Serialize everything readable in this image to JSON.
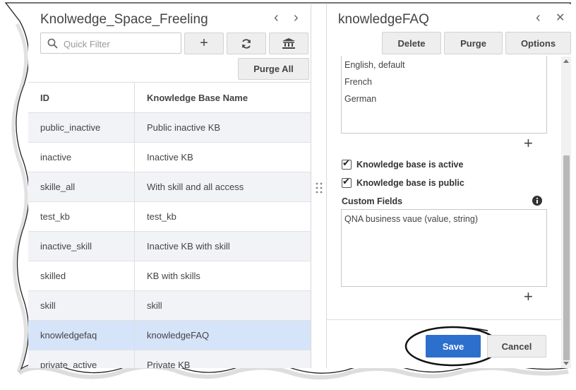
{
  "left_panel": {
    "title": "Knolwedge_Space_Freeling",
    "filter": {
      "placeholder": "Quick Filter",
      "value": ""
    },
    "buttons": {
      "add": "+",
      "refresh": "⟳",
      "kb": "🏛",
      "purge_all": "Purge All"
    },
    "table": {
      "headers": [
        "ID",
        "Knowledge Base Name"
      ],
      "rows": [
        [
          "public_inactive",
          "Public inactive KB"
        ],
        [
          "inactive",
          "Inactive KB"
        ],
        [
          "skille_all",
          "With skill and all access"
        ],
        [
          "test_kb",
          "test_kb"
        ],
        [
          "inactive_skill",
          "Inactive KB with skill"
        ],
        [
          "skilled",
          "KB with skills"
        ],
        [
          "skill",
          "skill"
        ],
        [
          "knowledgefaq",
          "knowledgeFAQ"
        ],
        [
          "private_active",
          "Private KB"
        ]
      ],
      "selected_row": 7
    }
  },
  "right_panel": {
    "title": "knowledgeFAQ",
    "buttons": {
      "delete": "Delete",
      "purge": "Purge",
      "options": "Options"
    },
    "languages": [
      "English, default",
      "French",
      "German"
    ],
    "checkboxes": {
      "active": {
        "label": "Knowledge base is active",
        "checked": true
      },
      "public": {
        "label": "Knowledge base is public",
        "checked": true
      }
    },
    "custom_fields": {
      "label": "Custom Fields",
      "items": [
        "QNA business vaue (value, string)"
      ]
    },
    "footer": {
      "save": "Save",
      "cancel": "Cancel"
    }
  },
  "colors": {
    "accent": "#2d6fcd",
    "selected_row": "#d6e4fa"
  }
}
